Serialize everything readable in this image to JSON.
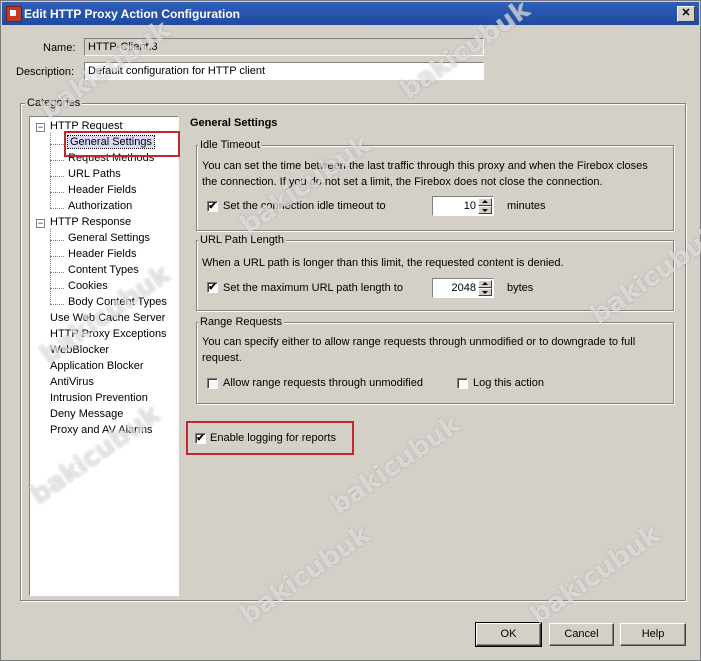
{
  "window": {
    "title": "Edit HTTP Proxy Action Configuration",
    "close_label": "✕"
  },
  "form": {
    "name_label": "Name:",
    "name_value": "HTTP-Client.3",
    "description_label": "Description:",
    "description_value": "Default configuration for HTTP client"
  },
  "categories": {
    "legend": "Categories",
    "items": [
      {
        "label": "HTTP Request",
        "level": 0,
        "expandable": true
      },
      {
        "label": "General Settings",
        "level": 1,
        "selected": true
      },
      {
        "label": "Request Methods",
        "level": 1
      },
      {
        "label": "URL Paths",
        "level": 1
      },
      {
        "label": "Header Fields",
        "level": 1
      },
      {
        "label": "Authorization",
        "level": 1
      },
      {
        "label": "HTTP Response",
        "level": 0,
        "expandable": true
      },
      {
        "label": "General Settings",
        "level": 1
      },
      {
        "label": "Header Fields",
        "level": 1
      },
      {
        "label": "Content Types",
        "level": 1
      },
      {
        "label": "Cookies",
        "level": 1
      },
      {
        "label": "Body Content Types",
        "level": 1
      },
      {
        "label": "Use Web Cache Server",
        "level": 0
      },
      {
        "label": "HTTP Proxy Exceptions",
        "level": 0
      },
      {
        "label": "WebBlocker",
        "level": 0
      },
      {
        "label": "Application Blocker",
        "level": 0
      },
      {
        "label": "AntiVirus",
        "level": 0
      },
      {
        "label": "Intrusion Prevention",
        "level": 0
      },
      {
        "label": "Deny Message",
        "level": 0
      },
      {
        "label": "Proxy and AV Alarms",
        "level": 0
      }
    ]
  },
  "general": {
    "title": "General Settings",
    "idle": {
      "legend": "Idle Timeout",
      "description": "You can set the time between the last traffic through this proxy and when the Firebox closes the connection. If you do not set a limit, the Firebox does not close the connection.",
      "checkbox_label": "Set the connection idle timeout to",
      "checked": true,
      "value": "10",
      "unit": "minutes"
    },
    "url": {
      "legend": "URL Path Length",
      "description": "When a URL path is longer than this limit, the requested content is denied.",
      "checkbox_label": "Set the maximum URL path length to",
      "checked": true,
      "value": "2048",
      "unit": "bytes"
    },
    "range": {
      "legend": "Range Requests",
      "description": "You can specify either to allow range requests through unmodified or to downgrade to full request.",
      "allow_label": "Allow range requests through unmodified",
      "allow_checked": false,
      "log_label": "Log this action",
      "log_checked": false
    },
    "logging": {
      "label": "Enable logging for reports",
      "checked": true
    }
  },
  "buttons": {
    "ok": "OK",
    "cancel": "Cancel",
    "help": "Help"
  },
  "watermark": "bakicubuk",
  "colors": {
    "titlebar": "#1f4aa0",
    "highlight": "#c0282c",
    "dialog": "#d4d0c8"
  }
}
